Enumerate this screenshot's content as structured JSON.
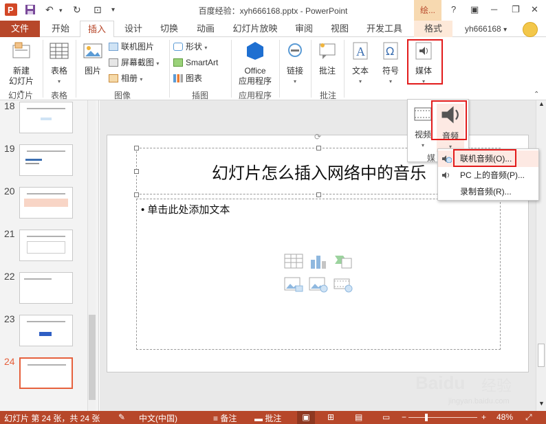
{
  "app": {
    "title": "百度经验：xyh666168.pptx - PowerPoint",
    "context_tab_group": "绘...",
    "user_name": "yh666168"
  },
  "window_controls": {
    "help": "?",
    "minimize": "─",
    "restore": "❐",
    "close": "✕"
  },
  "tabs": [
    {
      "label": "文件"
    },
    {
      "label": "开始"
    },
    {
      "label": "插入",
      "active": true
    },
    {
      "label": "设计"
    },
    {
      "label": "切换"
    },
    {
      "label": "动画"
    },
    {
      "label": "幻灯片放映"
    },
    {
      "label": "审阅"
    },
    {
      "label": "视图"
    },
    {
      "label": "开发工具"
    },
    {
      "label": "格式"
    }
  ],
  "ribbon": {
    "slides": {
      "new_slide": "新建\n幻灯片",
      "new_slide_l1": "新建",
      "new_slide_l2": "幻灯片",
      "group": "幻灯片"
    },
    "tables": {
      "table": "表格",
      "group": "表格"
    },
    "images": {
      "picture": "图片",
      "online_pictures": "联机图片",
      "screenshot": "屏幕截图",
      "album": "相册",
      "group": "图像"
    },
    "illustrations": {
      "shapes": "形状",
      "smartart": "SmartArt",
      "chart": "图表",
      "group": "插图"
    },
    "apps": {
      "office_l1": "Office",
      "office_l2": "应用程序",
      "group": "应用程序"
    },
    "links": {
      "link": "链接"
    },
    "comments": {
      "comment": "批注",
      "group": "批注"
    },
    "text": {
      "text": "文本"
    },
    "symbols": {
      "symbol": "符号"
    },
    "media": {
      "media": "媒体"
    }
  },
  "media_dropdown": {
    "video": "视频",
    "audio": "音频",
    "group_partial": "媒"
  },
  "audio_menu": [
    {
      "label": "联机音频(O)...",
      "highlighted": true
    },
    {
      "label": "PC 上的音频(P)..."
    },
    {
      "label": "录制音频(R)..."
    }
  ],
  "thumbnails": [
    {
      "num": "18"
    },
    {
      "num": "19"
    },
    {
      "num": "20"
    },
    {
      "num": "21"
    },
    {
      "num": "22"
    },
    {
      "num": "23"
    },
    {
      "num": "24",
      "active": true
    }
  ],
  "slide": {
    "title": "幻灯片怎么插入网络中的音乐",
    "content_placeholder": "• 单击此处添加文本"
  },
  "statusbar": {
    "slide_info": "幻灯片 第 24 张，共 24 张",
    "language": "中文(中国)",
    "notes": "备注",
    "comments": "批注",
    "zoom_minus": "−",
    "zoom_plus": "+",
    "zoom": "48%",
    "zoom_fraction": 0.48
  },
  "watermark": {
    "brand": "Baidu",
    "brand_cn": "经验",
    "url": "jingyan.baidu.com"
  },
  "colors": {
    "accent": "#b7472a",
    "highlight_box": "#e21a1a",
    "active_thumb": "#e6603c"
  }
}
